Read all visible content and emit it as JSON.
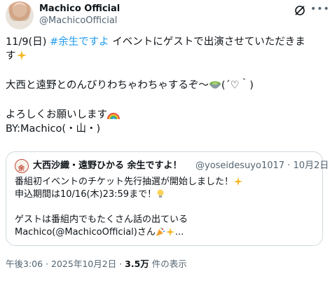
{
  "author": {
    "display_name": "Machico Official",
    "handle": "@MachicoOfficial"
  },
  "tweet": {
    "line1_pre": "11/9(日) ",
    "line1_hashtag": "#余生ですよ",
    "line1_post": " イベントにゲストで出演させていただきま",
    "line2": "す",
    "line3": "大西と遠野とのんびりわちゃわちゃするぞ〜",
    "line3_post": "(´♡｀)",
    "line4": "よろしくお願いします",
    "line5": "BY:Machico(・山・)"
  },
  "quote": {
    "avatar_text": "余",
    "name": "大西沙織・遠野ひかる 余生ですよ！",
    "handle": "@yoseidesuyo1017",
    "separator": "·",
    "date": "10月2日",
    "line1": "番組初イベントのチケット先行抽選が開始しました！",
    "line2": "申込期間は10/16(木)23:59まで！",
    "line3": "ゲストは番組内でもたくさん話の出ている",
    "line4": "Machico(@MachicoOfficial)さん",
    "line4_post": "..."
  },
  "footer": {
    "time": "午後3:06",
    "separator": "·",
    "date": "2025年10月2日",
    "separator2": "·",
    "views": "3.5万",
    "views_suffix": " 件の表示"
  },
  "icons": {
    "grok": "grok-icon",
    "more": "more-icon",
    "sparkles": "sparkles-emoji",
    "matcha": "matcha-emoji",
    "rainbow": "rainbow-emoji",
    "bulb": "lightbulb-emoji",
    "party": "party-popper-emoji"
  },
  "colors": {
    "link": "#1d9bf0",
    "secondary_text": "#536471",
    "border": "#cfd9de"
  }
}
